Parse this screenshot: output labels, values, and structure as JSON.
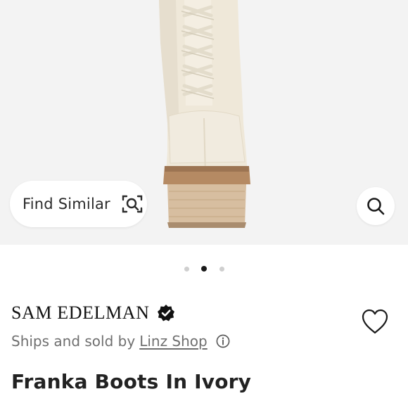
{
  "gallery": {
    "image_alt": "Franka Boots In Ivory",
    "find_similar_label": "Find Similar",
    "find_similar_icon": "scan-search-icon",
    "zoom_icon": "search-icon",
    "dots_count": 3,
    "active_dot_index": 1
  },
  "product": {
    "brand": "SAM EDELMAN",
    "verified_icon": "verified-badge-icon",
    "seller_prefix": "Ships and sold by",
    "seller_name": "Linz Shop",
    "info_icon": "info-icon",
    "like_icon": "heart-icon",
    "title": "Franka Boots In Ivory"
  },
  "colors": {
    "image_background": "#f3f3f3",
    "boot_ivory": "#efe8d9",
    "heel_tan": "#b08a66",
    "active_dot": "#1a1a1a",
    "inactive_dot": "#cfcfcf",
    "muted_text": "#6f6f6f"
  }
}
